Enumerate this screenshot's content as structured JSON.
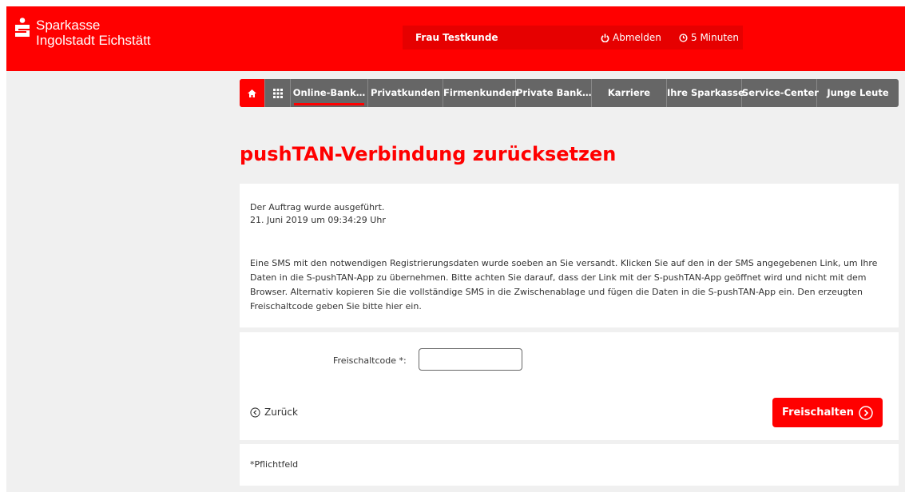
{
  "brand": {
    "line1": "Sparkasse",
    "line2": "Ingolstadt Eichstätt",
    "accent": "#ff0000"
  },
  "userbar": {
    "name": "Frau Testkunde",
    "logout": "Abmelden",
    "timer": "5 Minuten"
  },
  "nav": {
    "home_icon": "home-icon",
    "grid_icon": "grid-icon",
    "items": [
      {
        "label": "Online-Bank…",
        "active": true
      },
      {
        "label": "Privatkunden"
      },
      {
        "label": "Firmenkunden"
      },
      {
        "label": "Private Bank…"
      },
      {
        "label": "Karriere"
      },
      {
        "label": "Ihre Sparkasse"
      },
      {
        "label": "Service-Center"
      },
      {
        "label": "Junge Leute"
      }
    ]
  },
  "page": {
    "title": "pushTAN-Verbindung zurücksetzen"
  },
  "status": {
    "line1": "Der Auftrag wurde ausgeführt.",
    "line2": "21. Juni 2019 um 09:34:29 Uhr"
  },
  "info": "Eine SMS mit den notwendigen Registrierungsdaten wurde soeben an Sie versandt. Klicken Sie auf den in der SMS angegebenen Link, um Ihre Daten in die S-pushTAN-App zu übernehmen. Bitte achten Sie darauf, dass der Link mit der S-pushTAN-App geöffnet wird und nicht mit dem Browser. Alternativ kopieren Sie die vollständige SMS in die Zwischenablage und fügen die Daten in die S-pushTAN-App ein. Den erzeugten Freischaltcode geben Sie bitte hier ein.",
  "form": {
    "label": "Freischaltcode *:",
    "value": "",
    "back": "Zurück",
    "submit": "Freischalten"
  },
  "required_note": "*Pflichtfeld"
}
